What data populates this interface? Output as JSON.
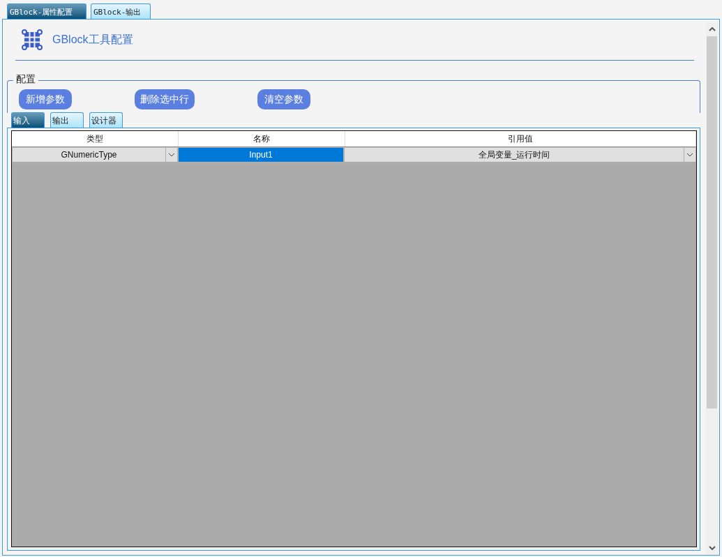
{
  "outer_tabs": [
    {
      "label": "GBlock-属性配置",
      "selected": true
    },
    {
      "label": "GBlock-输出",
      "selected": false
    }
  ],
  "header": {
    "title": "GBlock工具配置"
  },
  "group": {
    "title": "配置",
    "buttons": [
      "新增参数",
      "删除选中行",
      "清空参数"
    ]
  },
  "inner_tabs": [
    {
      "label": "输入",
      "selected": true
    },
    {
      "label": "输出",
      "selected": false
    },
    {
      "label": "设计器",
      "selected": false
    }
  ],
  "table": {
    "columns": [
      "类型",
      "名称",
      "引用值"
    ],
    "rows": [
      {
        "cells": [
          {
            "value": "GNumericType",
            "kind": "dropdown",
            "selected": false
          },
          {
            "value": "Input1",
            "kind": "text",
            "selected": true
          },
          {
            "value": "全局变量_运行时间",
            "kind": "dropdown",
            "selected": false
          }
        ]
      }
    ]
  }
}
